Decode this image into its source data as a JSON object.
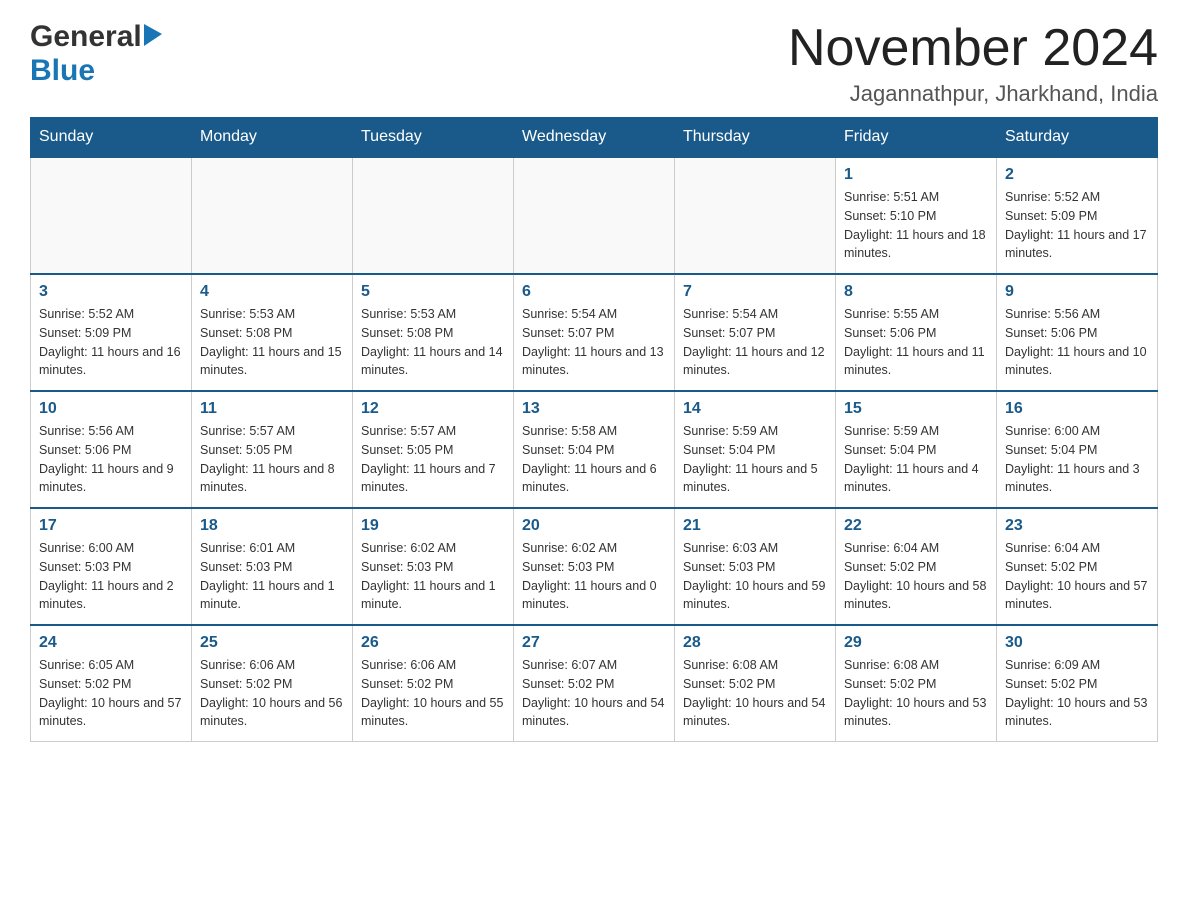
{
  "header": {
    "logo_general": "General",
    "logo_blue": "Blue",
    "month_title": "November 2024",
    "location": "Jagannathpur, Jharkhand, India"
  },
  "calendar": {
    "days_of_week": [
      "Sunday",
      "Monday",
      "Tuesday",
      "Wednesday",
      "Thursday",
      "Friday",
      "Saturday"
    ],
    "weeks": [
      [
        {
          "day": "",
          "info": ""
        },
        {
          "day": "",
          "info": ""
        },
        {
          "day": "",
          "info": ""
        },
        {
          "day": "",
          "info": ""
        },
        {
          "day": "",
          "info": ""
        },
        {
          "day": "1",
          "info": "Sunrise: 5:51 AM\nSunset: 5:10 PM\nDaylight: 11 hours and 18 minutes."
        },
        {
          "day": "2",
          "info": "Sunrise: 5:52 AM\nSunset: 5:09 PM\nDaylight: 11 hours and 17 minutes."
        }
      ],
      [
        {
          "day": "3",
          "info": "Sunrise: 5:52 AM\nSunset: 5:09 PM\nDaylight: 11 hours and 16 minutes."
        },
        {
          "day": "4",
          "info": "Sunrise: 5:53 AM\nSunset: 5:08 PM\nDaylight: 11 hours and 15 minutes."
        },
        {
          "day": "5",
          "info": "Sunrise: 5:53 AM\nSunset: 5:08 PM\nDaylight: 11 hours and 14 minutes."
        },
        {
          "day": "6",
          "info": "Sunrise: 5:54 AM\nSunset: 5:07 PM\nDaylight: 11 hours and 13 minutes."
        },
        {
          "day": "7",
          "info": "Sunrise: 5:54 AM\nSunset: 5:07 PM\nDaylight: 11 hours and 12 minutes."
        },
        {
          "day": "8",
          "info": "Sunrise: 5:55 AM\nSunset: 5:06 PM\nDaylight: 11 hours and 11 minutes."
        },
        {
          "day": "9",
          "info": "Sunrise: 5:56 AM\nSunset: 5:06 PM\nDaylight: 11 hours and 10 minutes."
        }
      ],
      [
        {
          "day": "10",
          "info": "Sunrise: 5:56 AM\nSunset: 5:06 PM\nDaylight: 11 hours and 9 minutes."
        },
        {
          "day": "11",
          "info": "Sunrise: 5:57 AM\nSunset: 5:05 PM\nDaylight: 11 hours and 8 minutes."
        },
        {
          "day": "12",
          "info": "Sunrise: 5:57 AM\nSunset: 5:05 PM\nDaylight: 11 hours and 7 minutes."
        },
        {
          "day": "13",
          "info": "Sunrise: 5:58 AM\nSunset: 5:04 PM\nDaylight: 11 hours and 6 minutes."
        },
        {
          "day": "14",
          "info": "Sunrise: 5:59 AM\nSunset: 5:04 PM\nDaylight: 11 hours and 5 minutes."
        },
        {
          "day": "15",
          "info": "Sunrise: 5:59 AM\nSunset: 5:04 PM\nDaylight: 11 hours and 4 minutes."
        },
        {
          "day": "16",
          "info": "Sunrise: 6:00 AM\nSunset: 5:04 PM\nDaylight: 11 hours and 3 minutes."
        }
      ],
      [
        {
          "day": "17",
          "info": "Sunrise: 6:00 AM\nSunset: 5:03 PM\nDaylight: 11 hours and 2 minutes."
        },
        {
          "day": "18",
          "info": "Sunrise: 6:01 AM\nSunset: 5:03 PM\nDaylight: 11 hours and 1 minute."
        },
        {
          "day": "19",
          "info": "Sunrise: 6:02 AM\nSunset: 5:03 PM\nDaylight: 11 hours and 1 minute."
        },
        {
          "day": "20",
          "info": "Sunrise: 6:02 AM\nSunset: 5:03 PM\nDaylight: 11 hours and 0 minutes."
        },
        {
          "day": "21",
          "info": "Sunrise: 6:03 AM\nSunset: 5:03 PM\nDaylight: 10 hours and 59 minutes."
        },
        {
          "day": "22",
          "info": "Sunrise: 6:04 AM\nSunset: 5:02 PM\nDaylight: 10 hours and 58 minutes."
        },
        {
          "day": "23",
          "info": "Sunrise: 6:04 AM\nSunset: 5:02 PM\nDaylight: 10 hours and 57 minutes."
        }
      ],
      [
        {
          "day": "24",
          "info": "Sunrise: 6:05 AM\nSunset: 5:02 PM\nDaylight: 10 hours and 57 minutes."
        },
        {
          "day": "25",
          "info": "Sunrise: 6:06 AM\nSunset: 5:02 PM\nDaylight: 10 hours and 56 minutes."
        },
        {
          "day": "26",
          "info": "Sunrise: 6:06 AM\nSunset: 5:02 PM\nDaylight: 10 hours and 55 minutes."
        },
        {
          "day": "27",
          "info": "Sunrise: 6:07 AM\nSunset: 5:02 PM\nDaylight: 10 hours and 54 minutes."
        },
        {
          "day": "28",
          "info": "Sunrise: 6:08 AM\nSunset: 5:02 PM\nDaylight: 10 hours and 54 minutes."
        },
        {
          "day": "29",
          "info": "Sunrise: 6:08 AM\nSunset: 5:02 PM\nDaylight: 10 hours and 53 minutes."
        },
        {
          "day": "30",
          "info": "Sunrise: 6:09 AM\nSunset: 5:02 PM\nDaylight: 10 hours and 53 minutes."
        }
      ]
    ]
  }
}
